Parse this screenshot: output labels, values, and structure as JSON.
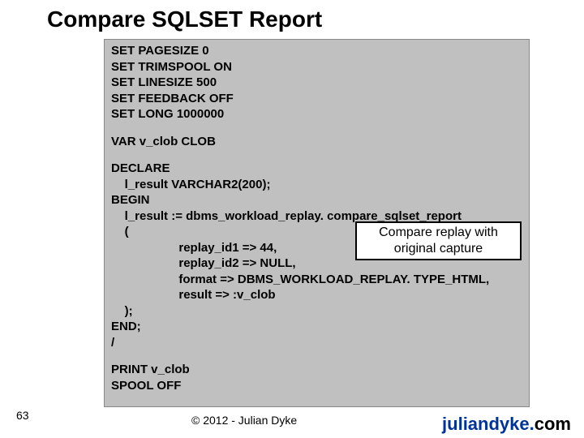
{
  "title": "Compare SQLSET Report",
  "code": {
    "settings": "SET PAGESIZE 0\nSET TRIMSPOOL ON\nSET LINESIZE 500\nSET FEEDBACK OFF\nSET LONG 1000000",
    "var": "VAR v_clob CLOB",
    "plsql": "DECLARE\n    l_result VARCHAR2(200);\nBEGIN\n    l_result := dbms_workload_replay. compare_sqlset_report\n    (\n                    replay_id1 => 44,\n                    replay_id2 => NULL,\n                    format => DBMS_WORKLOAD_REPLAY. TYPE_HTML,\n                    result => :v_clob\n    );\nEND;\n/",
    "tail": "PRINT v_clob\nSPOOL OFF"
  },
  "callout": "Compare replay with original capture",
  "slide_number": "63",
  "copyright": "© 2012 - Julian Dyke",
  "site_main": "juliandyke.",
  "site_tld": "com"
}
